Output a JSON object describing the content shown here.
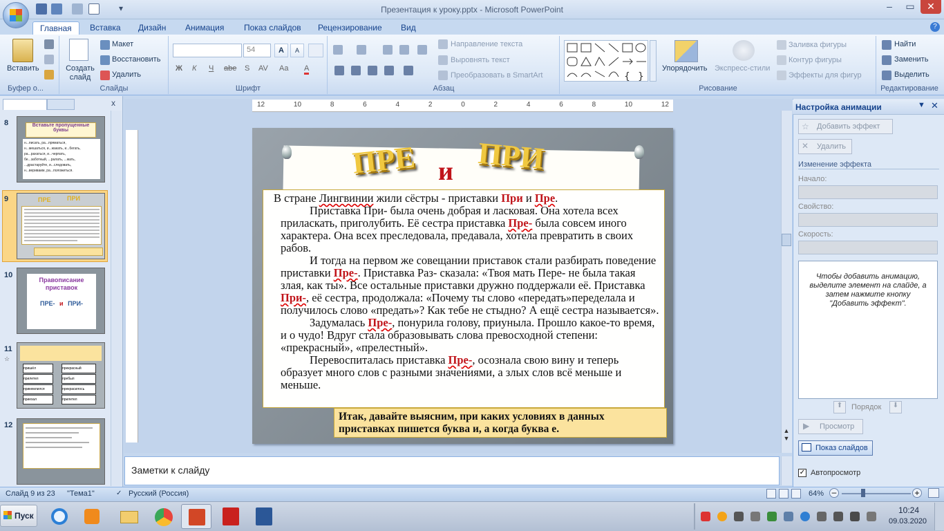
{
  "window": {
    "title": "Презентация к уроку.pptx - Microsoft PowerPoint",
    "minimize": "–",
    "restore": "▭",
    "close": "✕"
  },
  "tabs": [
    "Главная",
    "Вставка",
    "Дизайн",
    "Анимация",
    "Показ слайдов",
    "Рецензирование",
    "Вид"
  ],
  "ribbon": {
    "clipboard": {
      "paste": "Вставить",
      "label": "Буфер о..."
    },
    "slides": {
      "new_slide": "Создать слайд",
      "layout": "Макет",
      "reset": "Восстановить",
      "delete": "Удалить",
      "label": "Слайды"
    },
    "font": {
      "font_size": "54",
      "bold": "Ж",
      "italic": "К",
      "underline": "Ч",
      "strike": "abe",
      "shadow": "S",
      "spacing": "AV",
      "case": "Aa",
      "color": "A",
      "grow": "A",
      "shrink": "A",
      "label": "Шрифт"
    },
    "paragraph": {
      "text_direction": "Направление текста",
      "align_text": "Выровнять текст",
      "smartart": "Преобразовать в SmartArt",
      "label": "Абзац"
    },
    "drawing": {
      "arrange": "Упорядочить",
      "quick_styles": "Экспресс-стили",
      "fill": "Заливка фигуры",
      "outline": "Контур фигуры",
      "effects": "Эффекты для фигур",
      "label": "Рисование"
    },
    "editing": {
      "find": "Найти",
      "replace": "Заменить",
      "select": "Выделить",
      "label": "Редактирование"
    }
  },
  "left_panel": {
    "slides": [
      {
        "num": "8",
        "title": "Вставьте пропущенные буквы",
        "lines": [
          "н...писать, ра...пряматься,",
          "н...мешаться, и...жакать, и...бегать,",
          "ра...рахаться, и...черпать,",
          "бе...заботный, ...ралать, ...жать,",
          "...драстаруйте, и...следовать,",
          "н...вериваим, ра...положиться."
        ]
      },
      {
        "num": "9",
        "title_left": "ПРЕ",
        "title_right": "ПРИ"
      },
      {
        "num": "10",
        "title": "Правописание приставок",
        "sub1": "ПРЕ-",
        "sub2": "и",
        "sub3": "ПРИ-"
      },
      {
        "num": "11",
        "words_left": [
          "пришёл",
          "прилетел",
          "прикемлился",
          "приехал"
        ],
        "words_right": [
          "прекрасный",
          "пребыл",
          "прекрасилось",
          "прилетел"
        ]
      },
      {
        "num": "12"
      }
    ]
  },
  "slide": {
    "wordart_left": "ПРЕ",
    "wordart_mid": "и",
    "wordart_right": "ПРИ",
    "paragraphs": [
      {
        "parts": [
          "В стране ",
          "Лингвинии",
          " жили сёстры - приставки ",
          "При",
          " и ",
          "Пре",
          "."
        ]
      },
      {
        "parts": [
          "Приставка При- была очень добрая и ласковая. Она хотела всех приласкать, приголубить. Её сестра приставка ",
          "Пре-",
          " была совсем иного характера. Она всех преследовала, предавала, хотела превратить в своих рабов."
        ]
      },
      {
        "parts": [
          "И тогда на первом же совещании приставок стали разбирать поведение приставки ",
          "Пре-",
          ". Приставка Раз- сказала: «Твоя мать Пере- не была такая злая, как ты». Все остальные приставки дружно поддержали её. Приставка ",
          "При-",
          ", её сестра, продолжала: «Почему ты слово «передать»переделала и получилось слово «предать»? Как тебе не стыдно? А ещё сестра называется»."
        ]
      },
      {
        "parts": [
          "Задумалась ",
          "Пре-",
          ", понурила голову, приуныла. Прошло какое-то время, и о чудо! Вдруг стала образовывать слова превосходной степени: «прекрасный», «прелестный»."
        ]
      },
      {
        "parts": [
          "Перевоспиталась приставка ",
          "Пре-",
          ", осознала свою вину и теперь образует много слов с разными значениями, а злых слов всё меньше и меньше."
        ]
      }
    ],
    "conclusion": "Итак, давайте выясним, при каких условиях в данных приставках пишется буква и, а когда буква е."
  },
  "ruler": {
    "ticks": [
      "12",
      "10",
      "8",
      "6",
      "4",
      "2",
      "0",
      "2",
      "4",
      "6",
      "8",
      "10",
      "12"
    ]
  },
  "notes": {
    "placeholder": "Заметки к слайду"
  },
  "animation_pane": {
    "title": "Настройка анимации",
    "add_effect": "Добавить эффект",
    "remove": "Удалить",
    "change_effect": "Изменение эффекта",
    "start_label": "Начало:",
    "property_label": "Свойство:",
    "speed_label": "Скорость:",
    "hint": "Чтобы добавить анимацию, выделите элемент на слайде, а затем нажмите кнопку \"Добавить эффект\".",
    "reorder": "Порядок",
    "preview": "Просмотр",
    "slideshow": "Показ слайдов",
    "autopreview": "Автопросмотр"
  },
  "status": {
    "slide_info": "Слайд 9 из 23",
    "theme": "\"Тема1\"",
    "language": "Русский (Россия)",
    "zoom": "64%"
  },
  "taskbar": {
    "start": "Пуск",
    "time": "10:24",
    "date": "09.03.2020"
  },
  "colors": {
    "accent_red": "#c0141a",
    "wordart_gold": "#f0c840",
    "conclusion_bg": "#fbe39e"
  }
}
